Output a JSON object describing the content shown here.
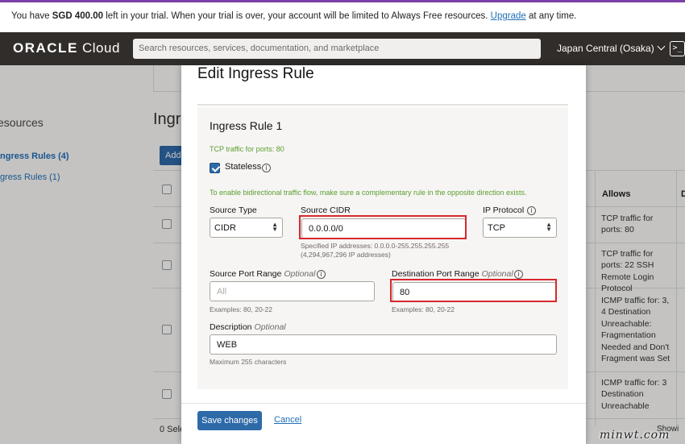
{
  "banner": {
    "prefix": "You have ",
    "amount": "SGD 400.00",
    "middle": " left in your trial. When your trial is over, your account will be limited to Always Free resources. ",
    "upgrade_link": "Upgrade",
    "suffix": " at any time."
  },
  "topbar": {
    "logo_oracle": "ORACLE",
    "logo_cloud": " Cloud",
    "search_placeholder": "Search resources, services, documentation, and marketplace",
    "region": "Japan Central (Osaka)",
    "shell_icon": ">_"
  },
  "background": {
    "resources_heading": "esources",
    "sidebar_links": [
      "ngress Rules (4)",
      "gress Rules (1)"
    ],
    "section_heading": "Ingr",
    "add_button": "Add",
    "allows_header": "Allows",
    "d_header": "D",
    "allows_cells": [
      "TCP traffic for ports: 80",
      "TCP traffic for ports: 22 SSH Remote Login Protocol",
      "ICMP traffic for: 3, 4 Destination Unreachable: Fragmentation Needed and Don't Fragment was Set",
      "ICMP traffic for: 3 Destination Unreachable"
    ],
    "selected_count": "0 Sele",
    "showing": "Showi"
  },
  "modal": {
    "title": "Edit Ingress Rule",
    "rule_title": "Ingress Rule 1",
    "rule_summary": "TCP traffic for ports: 80",
    "stateless_label": "Stateless",
    "stateless_checked": true,
    "bidirectional_note": "To enable bidirectional traffic flow, make sure a complementary rule in the opposite direction exists.",
    "source_type": {
      "label": "Source Type",
      "value": "CIDR"
    },
    "source_cidr": {
      "label": "Source CIDR",
      "value": "0.0.0.0/0",
      "hint1": "Specified IP addresses: 0.0.0.0-255.255.255.255",
      "hint2": "(4,294,967,296 IP addresses)"
    },
    "ip_protocol": {
      "label": "IP Protocol",
      "value": "TCP"
    },
    "source_port_range": {
      "label": "Source Port Range",
      "optional": "Optional",
      "placeholder": "All",
      "hint": "Examples: 80, 20-22"
    },
    "destination_port_range": {
      "label": "Destination Port Range",
      "optional": "Optional",
      "value": "80",
      "hint": "Examples: 80, 20-22"
    },
    "description": {
      "label": "Description",
      "optional": "Optional",
      "value": "WEB",
      "hint": "Maximum 255 characters"
    },
    "save_button": "Save changes",
    "cancel_link": "Cancel"
  },
  "watermark": "minwt.com",
  "colors": {
    "accent": "#2e6aa8",
    "topbar": "#312d2a",
    "highlight": "#d8282c",
    "success_text": "#5b9e2d"
  }
}
